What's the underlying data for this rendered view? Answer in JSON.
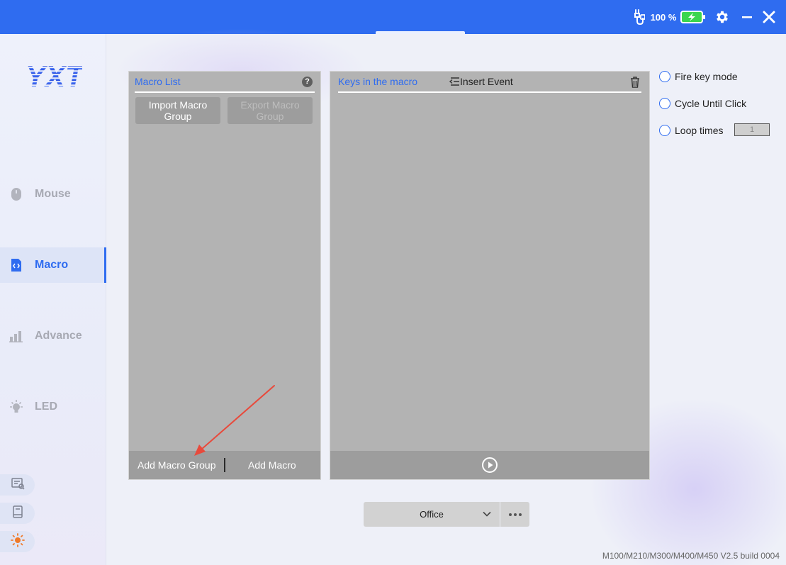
{
  "titlebar": {
    "battery_percent": "100 %",
    "battery_level": 1.0,
    "icons": [
      "usb-cable-icon",
      "battery-charging-icon",
      "gear-icon",
      "minimize-icon",
      "close-icon"
    ]
  },
  "sidebar": {
    "logo_text": "YXT",
    "items": [
      {
        "label": "Mouse",
        "icon": "mouse-icon",
        "active": false
      },
      {
        "label": "Macro",
        "icon": "macro-file-icon",
        "active": true
      },
      {
        "label": "Advance",
        "icon": "bar-chart-icon",
        "active": false
      },
      {
        "label": "LED",
        "icon": "bulb-icon",
        "active": false
      }
    ],
    "quick_icons": [
      "feedback-icon",
      "manual-book-icon",
      "sun-theme-icon"
    ]
  },
  "macro_list": {
    "title": "Macro List",
    "help_icon": "?",
    "import_label": "Import Macro Group",
    "export_label": "Export Macro Group",
    "add_group_label": "Add Macro Group",
    "add_macro_label": "Add Macro"
  },
  "keys_panel": {
    "title": "Keys in the macro",
    "insert_label": "Insert Event",
    "icons": [
      "insert-event-icon",
      "trash-icon",
      "play-icon"
    ]
  },
  "options": {
    "fire_key_mode": "Fire key mode",
    "cycle_until_click": "Cycle Until Click",
    "loop_times": "Loop times",
    "loop_value": "1"
  },
  "profile": {
    "selected": "Office"
  },
  "version": "M100/M210/M300/M400/M450 V2.5 build 0004",
  "colors": {
    "accent": "#2f6cf0",
    "panel_gray": "#b3b3b3",
    "footer_gray": "#9d9d9d",
    "annotation_arrow": "#e84a3c"
  }
}
